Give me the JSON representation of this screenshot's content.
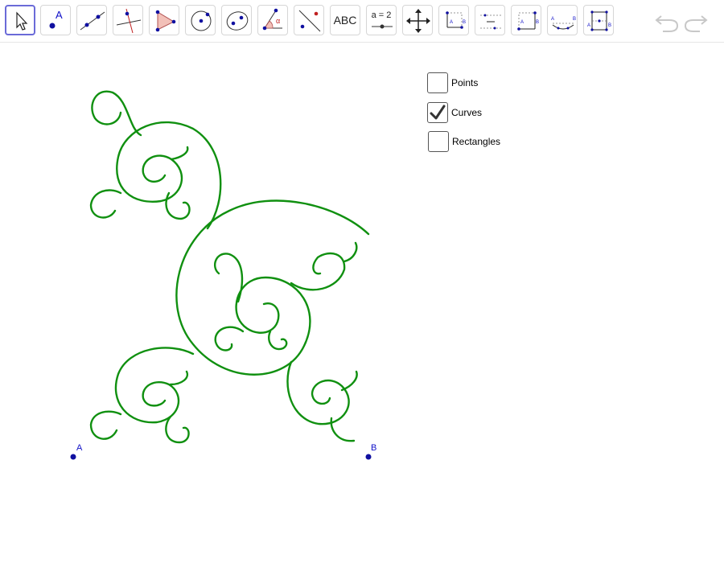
{
  "toolbar": {
    "tools": [
      {
        "name": "move",
        "label": ""
      },
      {
        "name": "point",
        "label": "A"
      },
      {
        "name": "line",
        "label": ""
      },
      {
        "name": "perpendicular",
        "label": ""
      },
      {
        "name": "polygon",
        "label": ""
      },
      {
        "name": "circle",
        "label": ""
      },
      {
        "name": "ellipse",
        "label": ""
      },
      {
        "name": "angle",
        "label": "α"
      },
      {
        "name": "reflect",
        "label": ""
      },
      {
        "name": "text",
        "label": "ABC"
      },
      {
        "name": "slider",
        "label": "a = 2"
      },
      {
        "name": "move-graphics",
        "label": ""
      }
    ],
    "custom_tool_labels": [
      "A",
      "B",
      "A",
      "B",
      "A",
      "B",
      "A",
      "B"
    ]
  },
  "controls": {
    "points_label": "Points",
    "points_checked": false,
    "curves_label": "Curves",
    "curves_checked": true,
    "rectangles_label": "Rectangles",
    "rectangles_checked": false
  },
  "points": {
    "a_label": "A",
    "b_label": "B"
  },
  "colors": {
    "curve": "#109010",
    "point": "#1010a0",
    "active_tool_border": "#6a6ad8"
  }
}
